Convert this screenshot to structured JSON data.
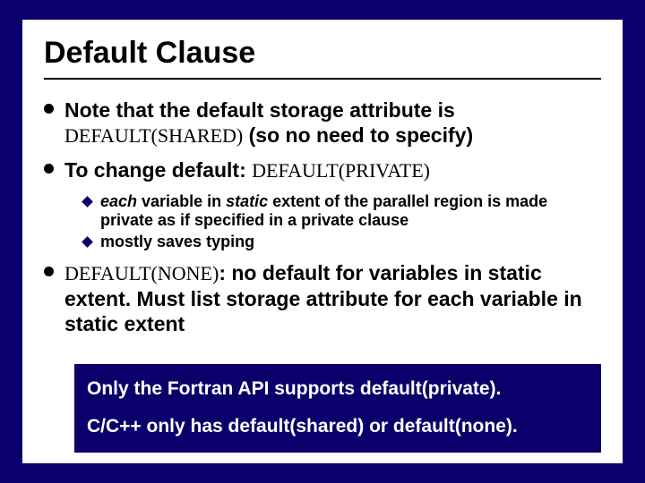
{
  "title": "Default Clause",
  "bullets": [
    {
      "prefix": "Note that the default storage attribute is ",
      "mono": "DEFAULT(SHARED)",
      "suffix": " (so no need to specify)"
    },
    {
      "prefix": "To change default: ",
      "mono": "DEFAULT(PRIVATE)",
      "suffix": "",
      "sub": [
        {
          "html": "<em>each</em> variable in <em>static</em> extent of the parallel region is made private as if specified in a private clause"
        },
        {
          "html": "mostly saves typing"
        }
      ]
    },
    {
      "mono_first": "DEFAULT(NONE)",
      "after": ": no default for variables in static extent.  Must list storage attribute for each variable in static extent"
    }
  ],
  "footer": {
    "line1": "Only the Fortran API supports default(private).",
    "line2": "C/C++ only has default(shared) or default(none)."
  }
}
